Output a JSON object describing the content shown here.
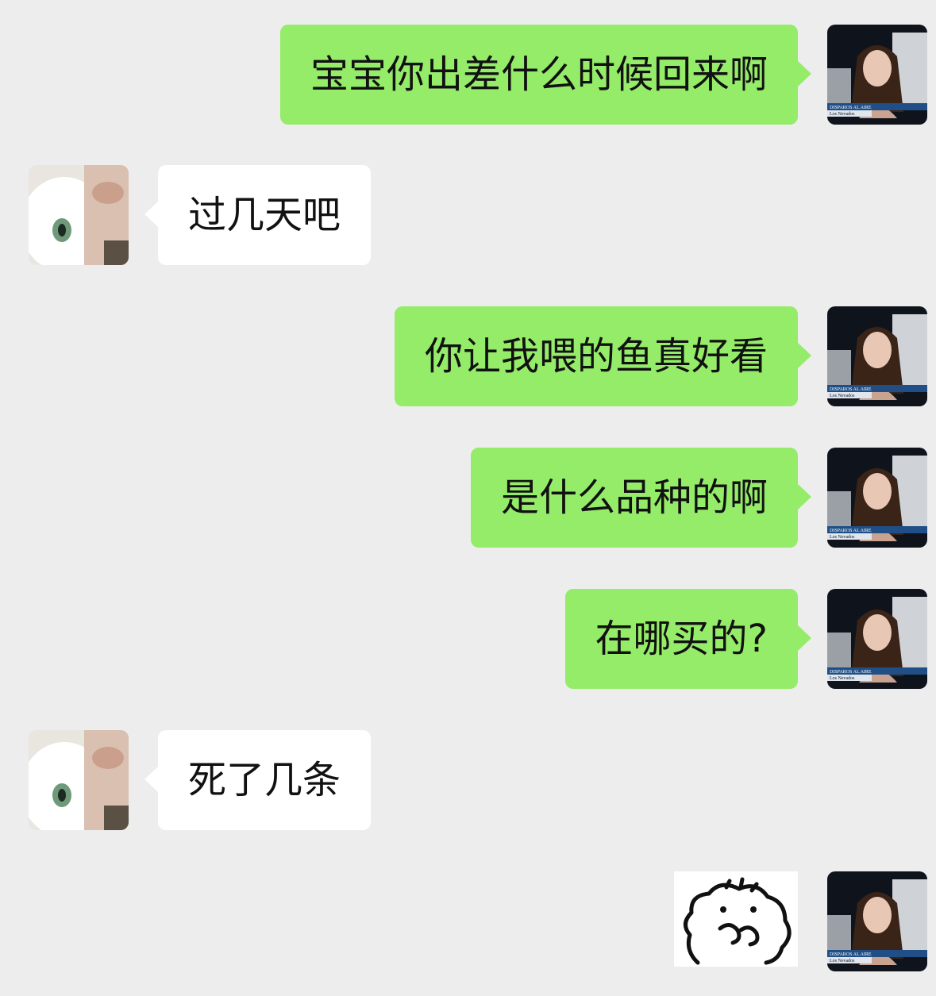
{
  "messages": [
    {
      "from": "me",
      "text": "宝宝你出差什么时候回来啊"
    },
    {
      "from": "them",
      "text": "过几天吧"
    },
    {
      "from": "me",
      "text": "你让我喂的鱼真好看"
    },
    {
      "from": "me",
      "text": "是什么品种的啊"
    },
    {
      "from": "me",
      "text": "在哪买的?"
    },
    {
      "from": "them",
      "text": "死了几条"
    },
    {
      "from": "me",
      "type": "sticker",
      "sticker": "hamster-sticker"
    }
  ],
  "avatars": {
    "me": {
      "caption_line1": "DISPAROS AL AIRE",
      "caption_line2": "Los Nevados"
    },
    "them": {}
  },
  "colors": {
    "background": "#ededed",
    "my_bubble": "#95ec69",
    "their_bubble": "#ffffff"
  }
}
